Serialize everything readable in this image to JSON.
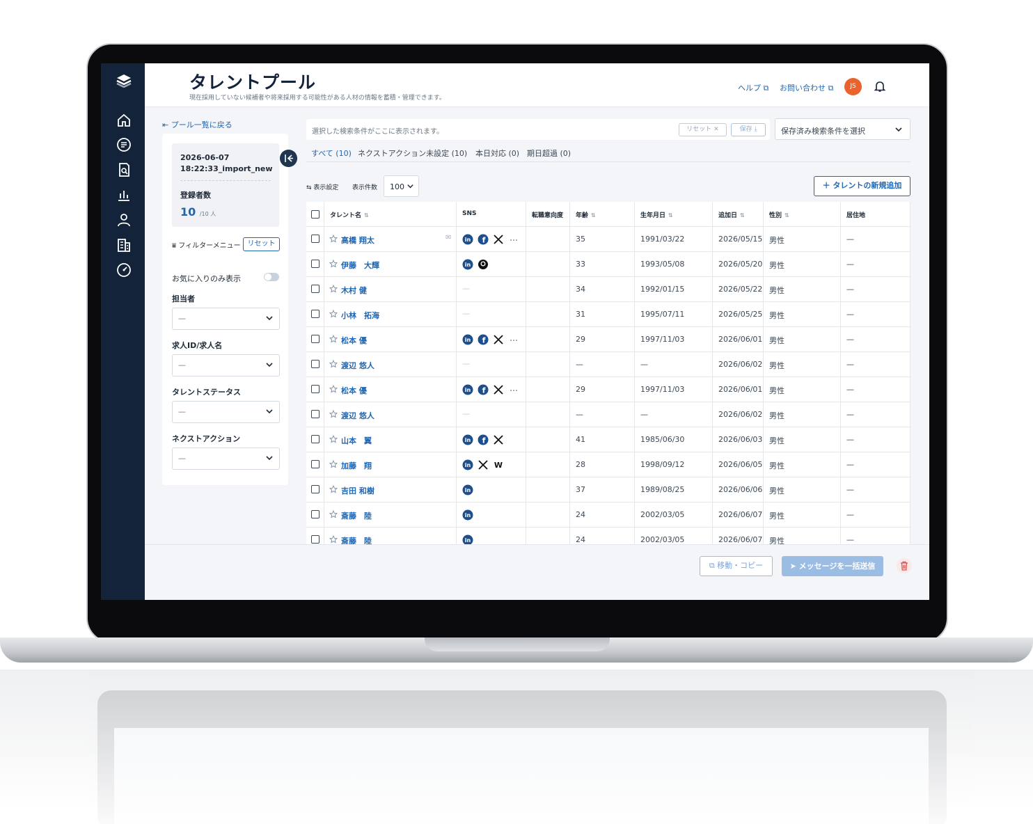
{
  "header": {
    "title": "タレントプール",
    "subtitle": "現在採用していない候補者や将来採用する可能性がある人材の情報を蓄積・管理できます。",
    "help": "ヘルプ",
    "contact": "お問い合わせ",
    "avatar_initials": "JS"
  },
  "left_panel": {
    "back_link": "プール一覧に戻る",
    "pool_date": "2026-06-07",
    "pool_name": "18:22:33_import_new",
    "registered_label": "登録者数",
    "registered_count": "10",
    "registered_total": "/10 人",
    "filter_menu_label": "フィルターメニュー",
    "reset_label": "リセット",
    "favorites_label": "お気に入りのみ表示",
    "filters": [
      {
        "label": "担当者",
        "value": "—"
      },
      {
        "label": "求人ID/求人名",
        "value": "—"
      },
      {
        "label": "タレントステータス",
        "value": "—"
      },
      {
        "label": "ネクストアクション",
        "value": "—"
      }
    ]
  },
  "search": {
    "placeholder": "選択した検索条件がここに表示されます。",
    "reset": "リセット ✕",
    "save": "保存 ⤓",
    "saved_select": "保存済み検索条件を選択"
  },
  "tabs": [
    {
      "label": "すべて (10)",
      "active": true
    },
    {
      "label": "ネクストアクション未設定 (10)",
      "active": false
    },
    {
      "label": "本日対応 (0)",
      "active": false
    },
    {
      "label": "期日超過 (0)",
      "active": false
    }
  ],
  "toolbar": {
    "display_settings": "表示設定",
    "per_page_label": "表示件数",
    "per_page_value": "100",
    "add_button": "＋ タレントの新規追加"
  },
  "table": {
    "columns": [
      "タレント名",
      "SNS",
      "転職意向度",
      "年齢",
      "生年月日",
      "追加日",
      "性別",
      "居住地"
    ],
    "rows": [
      {
        "name": "高橋 翔太",
        "sns": [
          "in",
          "fb",
          "x",
          "more"
        ],
        "mail": true,
        "age": "35",
        "birth": "1991/03/22",
        "added": "2026/05/15",
        "gender": "男性",
        "residence": "—"
      },
      {
        "name": "伊藤　大輝",
        "sns": [
          "in",
          "gh"
        ],
        "age": "33",
        "birth": "1993/05/08",
        "added": "2026/05/20",
        "gender": "男性",
        "residence": "—"
      },
      {
        "name": "木村 健",
        "sns": [],
        "age": "34",
        "birth": "1992/01/15",
        "added": "2026/05/22",
        "gender": "男性",
        "residence": "—"
      },
      {
        "name": "小林　拓海",
        "sns": [],
        "age": "31",
        "birth": "1995/07/11",
        "added": "2026/05/25",
        "gender": "男性",
        "residence": "—"
      },
      {
        "name": "松本 優",
        "sns": [
          "in",
          "fb",
          "x",
          "more"
        ],
        "age": "29",
        "birth": "1997/11/03",
        "added": "2026/06/01",
        "gender": "男性",
        "residence": "—"
      },
      {
        "name": "渡辺 悠人",
        "sns": [],
        "age": "—",
        "birth": "—",
        "added": "2026/06/02",
        "gender": "男性",
        "residence": "—"
      },
      {
        "name": "松本 優",
        "sns": [
          "in",
          "fb",
          "x",
          "more"
        ],
        "age": "29",
        "birth": "1997/11/03",
        "added": "2026/06/01",
        "gender": "男性",
        "residence": "—"
      },
      {
        "name": "渡辺 悠人",
        "sns": [],
        "age": "—",
        "birth": "—",
        "added": "2026/06/02",
        "gender": "男性",
        "residence": "—"
      },
      {
        "name": "山本　翼",
        "sns": [
          "in",
          "fb",
          "x"
        ],
        "age": "41",
        "birth": "1985/06/30",
        "added": "2026/06/03",
        "gender": "男性",
        "residence": "—"
      },
      {
        "name": "加藤　翔",
        "sns": [
          "in",
          "x",
          "w"
        ],
        "age": "28",
        "birth": "1998/09/12",
        "added": "2026/06/05",
        "gender": "男性",
        "residence": "—"
      },
      {
        "name": "吉田 和樹",
        "sns": [
          "in"
        ],
        "age": "37",
        "birth": "1989/08/25",
        "added": "2026/06/06",
        "gender": "男性",
        "residence": "—"
      },
      {
        "name": "斎藤　陸",
        "sns": [
          "in"
        ],
        "age": "24",
        "birth": "2002/03/05",
        "added": "2026/06/07",
        "gender": "男性",
        "residence": "—"
      },
      {
        "name": "斎藤　陸",
        "sns": [
          "in"
        ],
        "age": "24",
        "birth": "2002/03/05",
        "added": "2026/06/07",
        "gender": "男性",
        "residence": "—"
      }
    ]
  },
  "actions": {
    "move_copy": "移動・コピー",
    "bulk_message": "メッセージを一括送信"
  },
  "colors": {
    "nav_bg": "#13233a",
    "accent": "#1f66b3",
    "avatar": "#e8642c"
  }
}
